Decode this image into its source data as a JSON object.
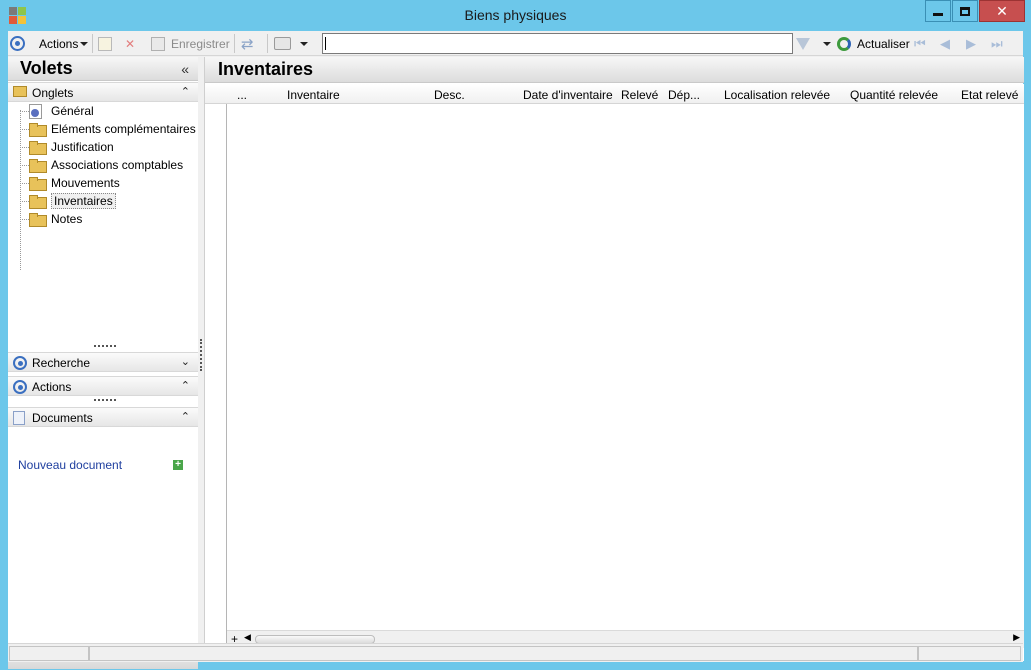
{
  "window": {
    "title": "Biens physiques"
  },
  "toolbar": {
    "actions_label": "Actions",
    "save_label": "Enregistrer",
    "search_value": "",
    "refresh_label": "Actualiser"
  },
  "left_pane": {
    "title": "Volets",
    "tabs_section": {
      "label": "Onglets",
      "items": [
        {
          "label": "Général",
          "icon": "settings-doc-icon"
        },
        {
          "label": "Eléments complémentaires",
          "icon": "folder-icon"
        },
        {
          "label": "Justification",
          "icon": "folder-icon"
        },
        {
          "label": "Associations comptables",
          "icon": "folder-icon"
        },
        {
          "label": "Mouvements",
          "icon": "folder-icon"
        },
        {
          "label": "Inventaires",
          "icon": "folder-open-icon",
          "selected": true
        },
        {
          "label": "Notes",
          "icon": "folder-icon"
        }
      ]
    },
    "search_section": {
      "label": "Recherche"
    },
    "actions_section": {
      "label": "Actions"
    },
    "documents_section": {
      "label": "Documents",
      "new_document": "Nouveau document"
    }
  },
  "main": {
    "title": "Inventaires",
    "grid": {
      "columns": [
        "...",
        "Inventaire",
        "Desc.",
        "Date d'inventaire",
        "Relevé",
        "Dép...",
        "Localisation relevée",
        "Quantité relevée",
        "Etat relevé"
      ],
      "rows": []
    }
  },
  "colors": {
    "titlebar": "#6cc7ea",
    "close_button": "#c74f4f",
    "link": "#1f3f9f",
    "accent_ring": "#3a6fc0"
  }
}
